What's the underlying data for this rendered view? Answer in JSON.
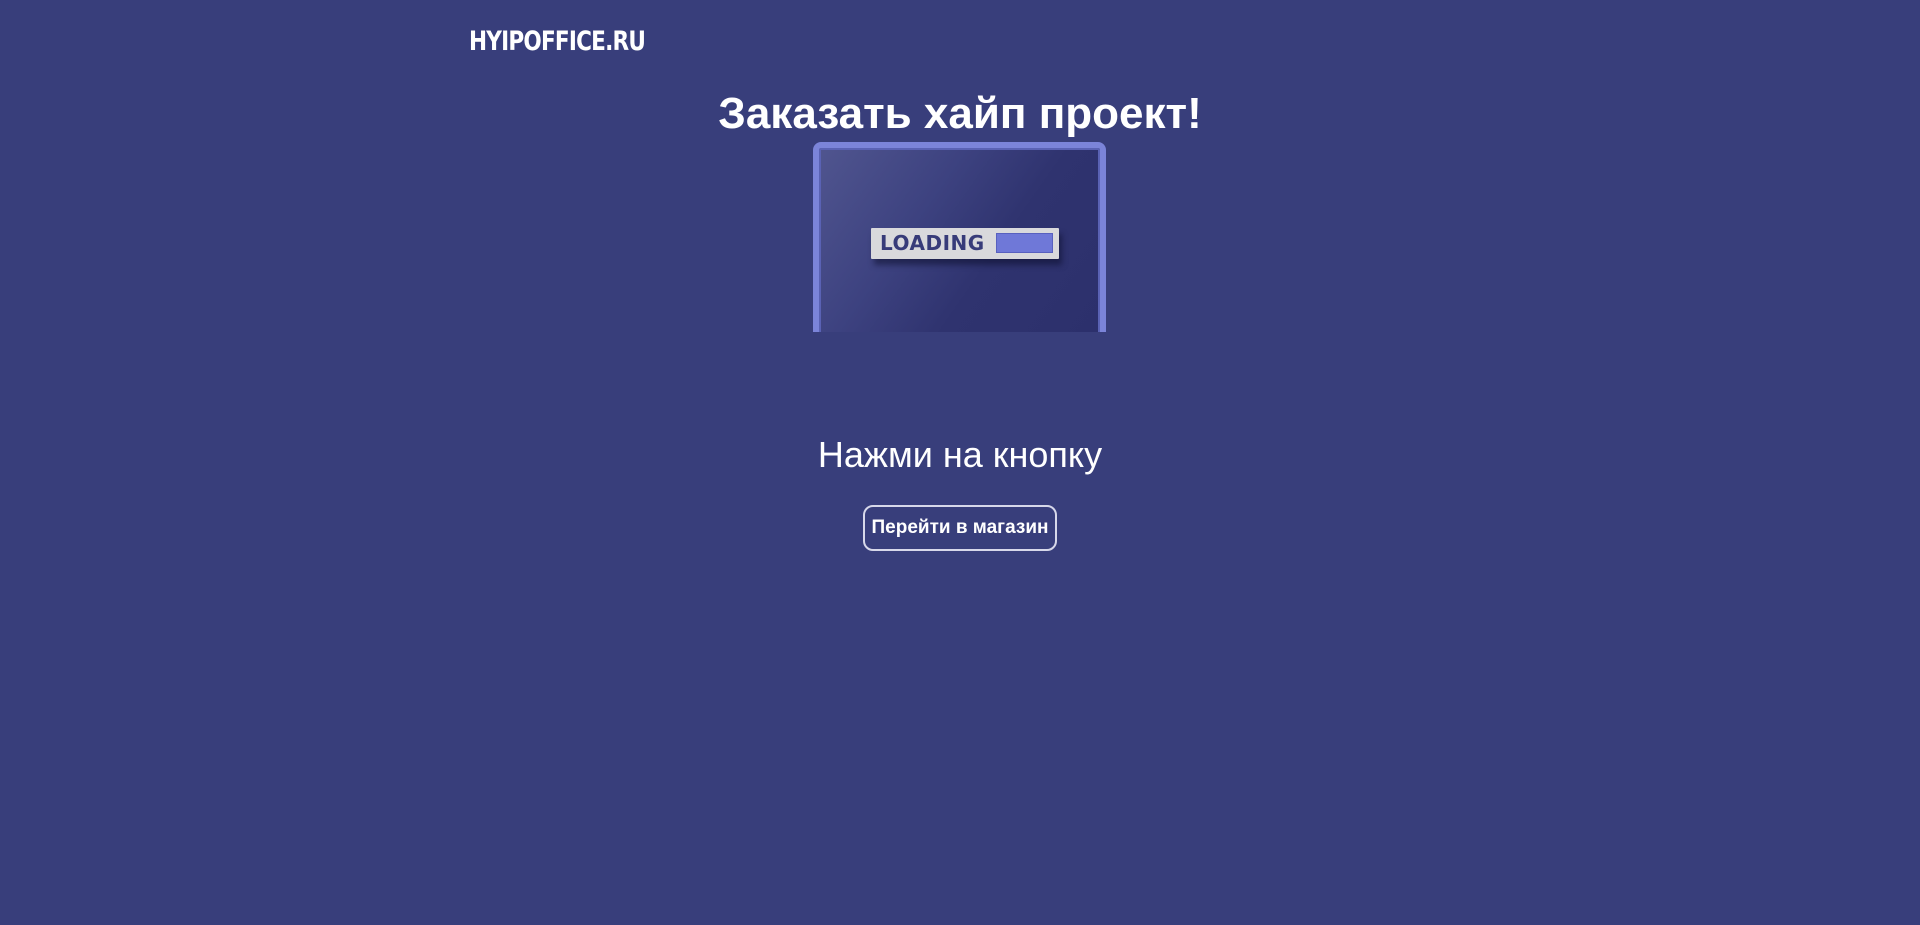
{
  "header": {
    "logo_text": "HYIPOFFICE.RU"
  },
  "main": {
    "title": "Заказать хайп проект!",
    "illustration": {
      "loading_label": "LOADING",
      "progress_fraction": 0.3
    },
    "subtitle": "Нажми на кнопку",
    "shop_button_label": "Перейти в магазин"
  },
  "colors": {
    "background": "#383e7b",
    "accent": "#7b84d9",
    "text": "#ffffff"
  }
}
